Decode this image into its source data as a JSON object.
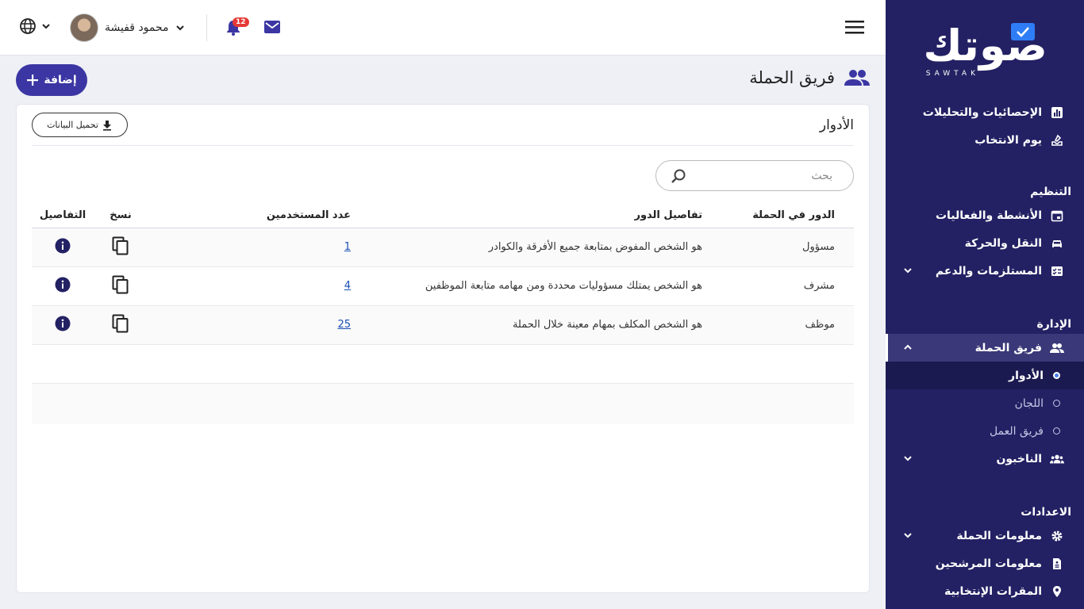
{
  "brand": {
    "name": "صوتك",
    "sub": "SAWTAK"
  },
  "topbar": {
    "user_name": "محمود قفيشة",
    "notifications_count": "12"
  },
  "sidebar": {
    "items_top": [
      {
        "label": "الإحصائيات والتحليلات",
        "icon": "chart-icon"
      },
      {
        "label": "يوم الانتخاب",
        "icon": "ballot-icon"
      }
    ],
    "section_org": "التنظيم",
    "items_org": [
      {
        "label": "الأنشطة والفعاليات",
        "icon": "calendar-icon"
      },
      {
        "label": "النقل والحركة",
        "icon": "car-icon"
      },
      {
        "label": "المستلزمات والدعم",
        "icon": "checklist-icon"
      }
    ],
    "section_admin": "الإدارة",
    "team": {
      "label": "فريق الحملة",
      "icon": "people-icon"
    },
    "team_sub": [
      {
        "label": "الأدوار"
      },
      {
        "label": "اللجان"
      },
      {
        "label": "فريق العمل"
      }
    ],
    "voters": {
      "label": "الناخبون",
      "icon": "group-icon"
    },
    "section_settings": "الاعدادات",
    "items_settings": [
      {
        "label": "معلومات الحملة",
        "icon": "gear-icon"
      },
      {
        "label": "معلومات المرشحين",
        "icon": "document-icon"
      },
      {
        "label": "المقرات الإنتخابية",
        "icon": "pin-icon"
      }
    ]
  },
  "page": {
    "title": "فريق الحملة",
    "add_label": "إضافة"
  },
  "card": {
    "title": "الأدوار",
    "download_label": "تحميل البيانات",
    "search_placeholder": "بحث"
  },
  "table": {
    "headers": [
      "الدور في الحملة",
      "تفاصيل الدور",
      "عدد المستخدمين",
      "نسخ",
      "التفاصيل"
    ],
    "rows": [
      {
        "role": "مسؤول",
        "desc": "هو الشخص المفوض بمتابعة جميع الأفرقة والكوادر",
        "users": "1"
      },
      {
        "role": "مشرف",
        "desc": "هو الشخص يمتلك مسؤوليات محددة ومن مهامه متابعة الموظفين",
        "users": "4"
      },
      {
        "role": "موظف",
        "desc": "هو الشخص المكلف بمهام معينة خلال الحملة",
        "users": "25"
      }
    ]
  },
  "colors": {
    "sidebar": "#232163",
    "accent": "#3b36a3",
    "link": "#1a4fb4",
    "badge": "#e53935"
  }
}
